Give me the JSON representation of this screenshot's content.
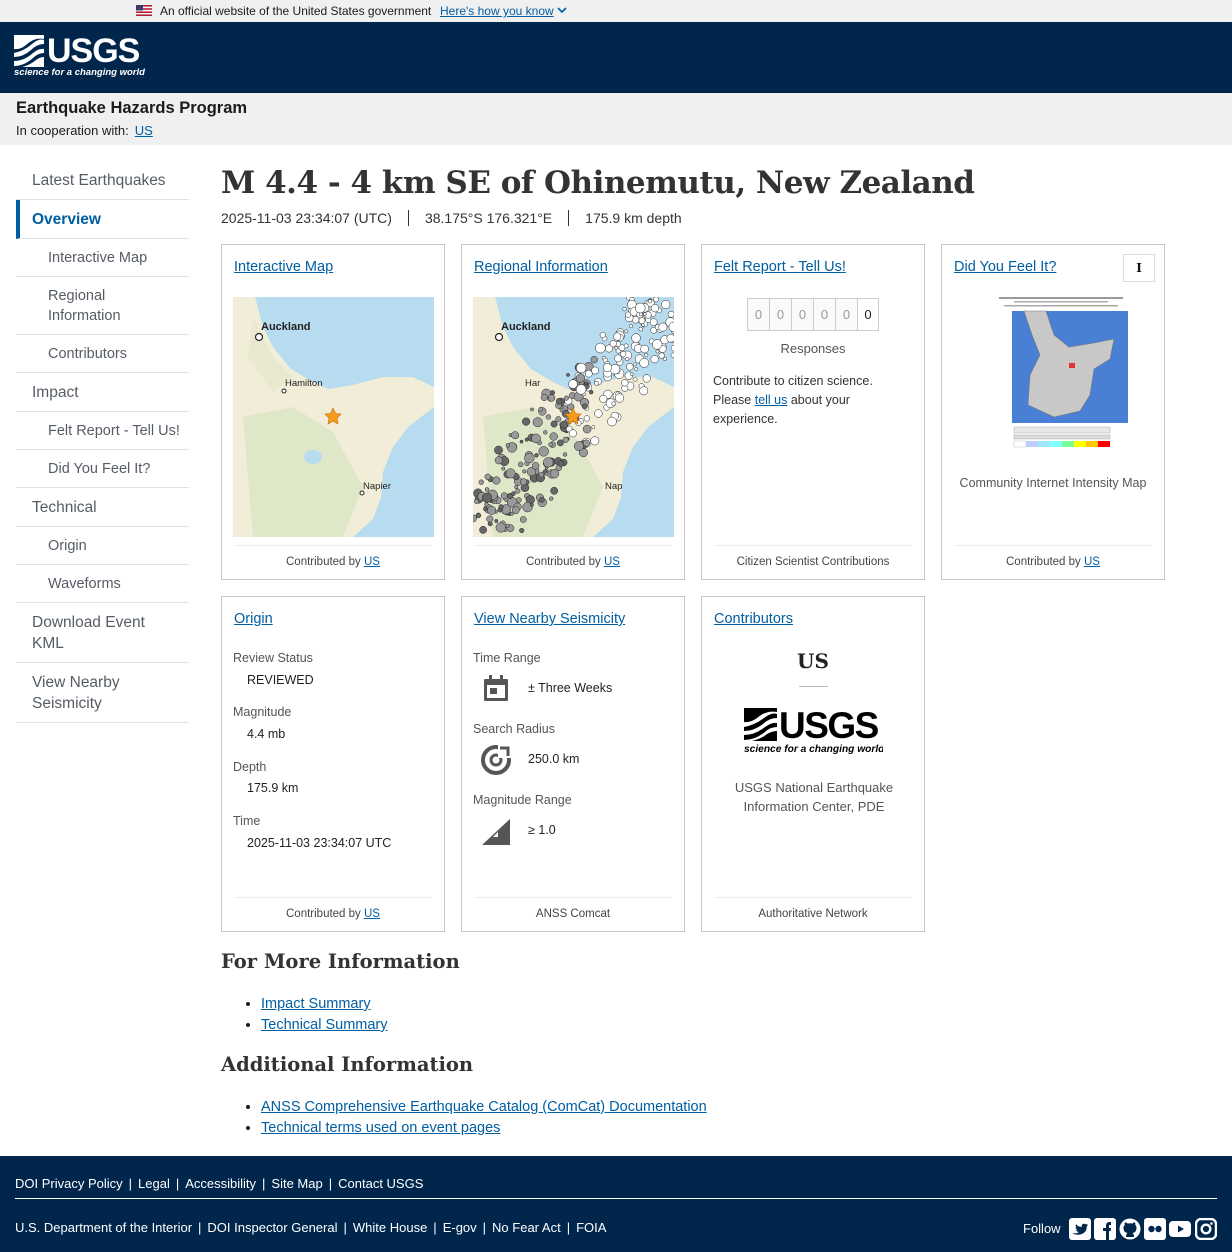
{
  "gov_banner": {
    "official": "An official website of the United States government",
    "how_to": "Here's how you know"
  },
  "program": {
    "title": "Earthquake Hazards Program",
    "coop_label": "In cooperation with:",
    "coop_link": "US"
  },
  "sidenav": {
    "items": [
      {
        "label": "Latest Earthquakes"
      },
      {
        "label": "Overview"
      },
      {
        "label": "Interactive Map"
      },
      {
        "label": "Regional Information"
      },
      {
        "label": "Contributors"
      },
      {
        "label": "Impact"
      },
      {
        "label": "Felt Report - Tell Us!"
      },
      {
        "label": "Did You Feel It?"
      },
      {
        "label": "Technical"
      },
      {
        "label": "Origin"
      },
      {
        "label": "Waveforms"
      },
      {
        "label": "Download Event KML"
      },
      {
        "label": "View Nearby Seismicity"
      }
    ]
  },
  "event": {
    "title": "M 4.4 - 4 km SE of Ohinemutu, New Zealand",
    "time": "2025-11-03 23:34:07 (UTC)",
    "location": "38.175°S 176.321°E",
    "depth": "175.9 km depth"
  },
  "cards": {
    "interactive_map": {
      "title": "Interactive Map",
      "contributed_by": "Contributed by",
      "contributor": "US",
      "labels": {
        "auckland": "Auckland",
        "hamilton": "Hamilton",
        "napier": "Napier"
      }
    },
    "regional": {
      "title": "Regional Information",
      "contributed_by": "Contributed by",
      "contributor": "US",
      "labels": {
        "auckland": "Auckland",
        "hamilton": "Har",
        "napier": "Nap"
      }
    },
    "felt_report": {
      "title": "Felt Report - Tell Us!",
      "digits": [
        "0",
        "0",
        "0",
        "0",
        "0",
        "0"
      ],
      "responses": "Responses",
      "text_before": "Contribute to citizen science. Please",
      "tell_us": "tell us",
      "text_after": "about your experience.",
      "footer": "Citizen Scientist Contributions"
    },
    "dyfi": {
      "title": "Did You Feel It?",
      "badge": "I",
      "caption": "Community Internet Intensity Map",
      "contributed_by": "Contributed by",
      "contributor": "US"
    },
    "origin": {
      "title": "Origin",
      "review_status_label": "Review Status",
      "review_status": "REVIEWED",
      "magnitude_label": "Magnitude",
      "magnitude": "4.4 mb",
      "depth_label": "Depth",
      "depth": "175.9 km",
      "time_label": "Time",
      "time": "2025-11-03 23:34:07 UTC",
      "contributed_by": "Contributed by",
      "contributor": "US"
    },
    "nearby": {
      "title": "View Nearby Seismicity",
      "time_range_label": "Time Range",
      "time_range": "± Three Weeks",
      "radius_label": "Search Radius",
      "radius": "250.0 km",
      "mag_range_label": "Magnitude Range",
      "mag_range": "≥ 1.0",
      "footer": "ANSS Comcat"
    },
    "contributors": {
      "title": "Contributors",
      "code": "US",
      "name": "USGS National Earthquake Information Center, PDE",
      "footer": "Authoritative Network"
    }
  },
  "more_info": {
    "heading": "For More Information",
    "links": [
      "Impact Summary",
      "Technical Summary"
    ]
  },
  "additional": {
    "heading": "Additional Information",
    "links": [
      "ANSS Comprehensive Earthquake Catalog (ComCat) Documentation",
      "Technical terms used on event pages"
    ]
  },
  "footer": {
    "row1": [
      "DOI Privacy Policy",
      "Legal",
      "Accessibility",
      "Site Map",
      "Contact USGS"
    ],
    "row2": [
      "U.S. Department of the Interior",
      "DOI Inspector General",
      "White House",
      "E-gov",
      "No Fear Act",
      "FOIA"
    ],
    "follow": "Follow",
    "social": [
      "twitter-icon",
      "facebook-icon",
      "github-icon",
      "flickr-icon",
      "youtube-icon",
      "instagram-icon"
    ]
  },
  "colors": {
    "header_navy": "#00264c",
    "link_blue": "#005ea2"
  }
}
